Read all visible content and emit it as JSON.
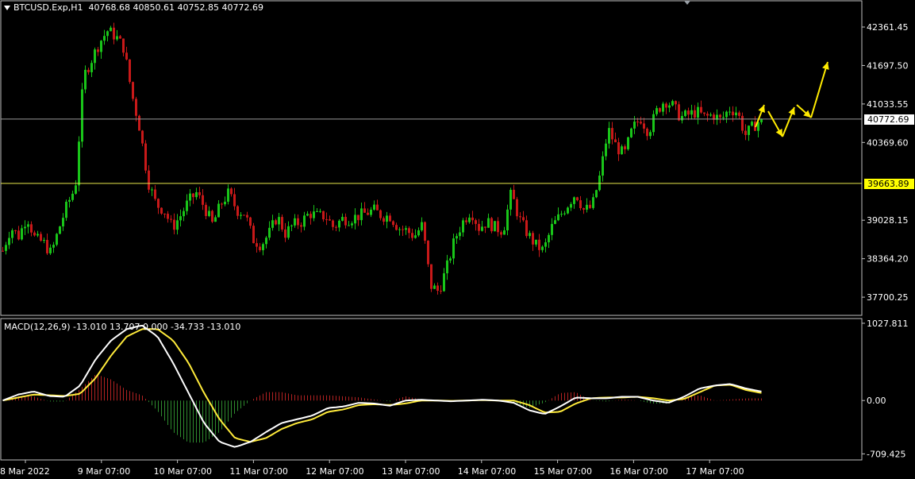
{
  "header": {
    "symbol": "BTCUSD.Exp,H1",
    "ohlc": "40768.68 40850.61 40752.85 40772.69"
  },
  "macd_header": "MACD(12,26,9) -13.010 13.707 0.000 -34.733 -13.010",
  "price_tags": {
    "bid": {
      "label": "40772.69",
      "value": 40772.69
    },
    "line2": {
      "label": "39663.89",
      "value": 39663.89
    }
  },
  "colors": {
    "background": "#000000",
    "bull": "#19c519",
    "bear": "#c81919",
    "macd_line": "#ffffff",
    "signal_line": "#ffeb3b",
    "arrow": "#ffeb00",
    "grid": "#808080"
  },
  "chart_data": [
    {
      "type": "candlestick",
      "title": "BTCUSD.Exp,H1",
      "ylim": [
        37400,
        42800
      ],
      "y_ticks": [
        "42361.45",
        "41697.50",
        "41033.55",
        "40369.60",
        "39028.15",
        "38364.20",
        "37700.25"
      ],
      "y_tick_values": [
        42361.45,
        41697.5,
        41033.55,
        40369.6,
        39028.15,
        38364.2,
        37700.25
      ],
      "x_ticks": [
        "8 Mar 2022",
        "9 Mar 07:00",
        "10 Mar 07:00",
        "11 Mar 07:00",
        "12 Mar 07:00",
        "13 Mar 07:00",
        "14 Mar 07:00",
        "15 Mar 07:00",
        "16 Mar 07:00",
        "17 Mar 07:00"
      ],
      "close_path": [
        38500,
        38900,
        38750,
        39100,
        38700,
        38650,
        38450,
        38900,
        39300,
        39600,
        41500,
        41800,
        42100,
        42300,
        42200,
        42000,
        41200,
        40600,
        39700,
        39300,
        39200,
        38900,
        39100,
        39350,
        39500,
        39250,
        38950,
        39300,
        39500,
        39200,
        39150,
        38700,
        38600,
        38800,
        39100,
        38800,
        38950,
        39000,
        39150,
        39100,
        39100,
        38900,
        39050,
        39050,
        39100,
        39150,
        39200,
        39100,
        39100,
        38900,
        38850,
        38750,
        38950,
        37900,
        37800,
        38200,
        38700,
        39000,
        39200,
        38900,
        39000,
        38900,
        38850,
        39500,
        39050,
        38800,
        38600,
        38500,
        38900,
        39100,
        39300,
        39500,
        39200,
        39250,
        39800,
        40600,
        40300,
        40150,
        40600,
        40800,
        40550,
        40900,
        41100,
        41000,
        40800,
        40850,
        40900,
        40800,
        40850,
        40750,
        40950,
        40900,
        40500,
        40650,
        40772.69
      ],
      "bull_start_prob": 0.5
    },
    {
      "type": "macd",
      "title": "MACD(12,26,9)",
      "ylim": [
        -780,
        1080
      ],
      "y_ticks": [
        "1027.811",
        "0.00",
        "-709.425"
      ],
      "y_tick_values": [
        1027.811,
        0,
        -709.425
      ],
      "macd": [
        0,
        80,
        120,
        60,
        50,
        200,
        550,
        800,
        950,
        1000,
        850,
        500,
        100,
        -300,
        -550,
        -620,
        -550,
        -420,
        -300,
        -250,
        -200,
        -100,
        -80,
        -30,
        -40,
        -70,
        0,
        10,
        0,
        -10,
        0,
        10,
        0,
        -30,
        -130,
        -180,
        -80,
        40,
        30,
        30,
        50,
        50,
        0,
        -30,
        50,
        160,
        200,
        220,
        160,
        120
      ],
      "signal": [
        0,
        40,
        80,
        70,
        60,
        90,
        300,
        600,
        850,
        950,
        950,
        800,
        500,
        100,
        -250,
        -500,
        -550,
        -500,
        -380,
        -300,
        -250,
        -150,
        -120,
        -60,
        -50,
        -60,
        -40,
        0,
        0,
        -5,
        0,
        5,
        0,
        0,
        -60,
        -160,
        -150,
        -40,
        30,
        40,
        40,
        50,
        30,
        0,
        20,
        110,
        200,
        210,
        140,
        100
      ],
      "histogram_scale": 1.0
    }
  ]
}
